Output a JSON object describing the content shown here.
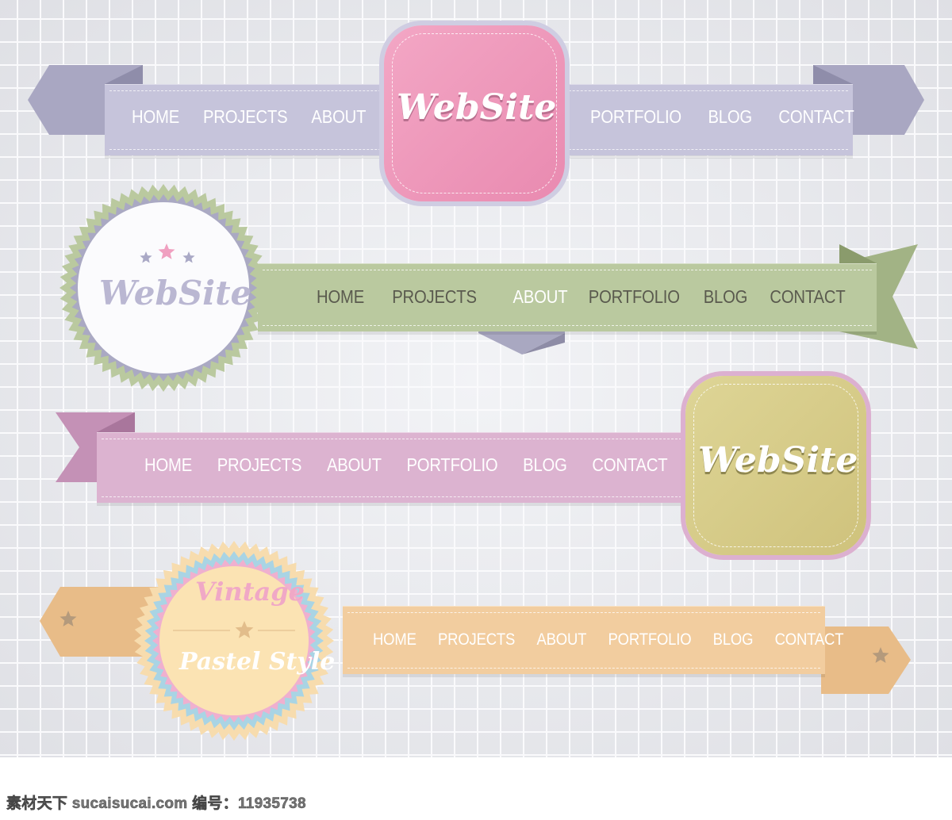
{
  "banners": [
    {
      "logo": "WebSite",
      "items_left": [
        "HOME",
        "PROJECTS",
        "ABOUT"
      ],
      "items_right": [
        "PORTFOLIO",
        "BLOG",
        "CONTACT"
      ],
      "colors": {
        "ribbon": "#c6c4db",
        "tail": "#a9a7c2",
        "badge": "#ef9cbd",
        "text": "#ffffff"
      }
    },
    {
      "logo": "WebSite",
      "items": [
        "HOME",
        "PROJECTS",
        "ABOUT",
        "PORTFOLIO",
        "BLOG",
        "CONTACT"
      ],
      "active": "ABOUT",
      "colors": {
        "ribbon": "#bac99f",
        "tail": "#a2b385",
        "active": "#a9a8c1",
        "text": "#5a5a4e",
        "logo": "#bab7d2"
      }
    },
    {
      "logo": "WebSite",
      "items": [
        "HOME",
        "PROJECTS",
        "ABOUT",
        "PORTFOLIO",
        "BLOG",
        "CONTACT"
      ],
      "colors": {
        "ribbon": "#dcb3d0",
        "tail": "#c491b6",
        "badge": "#d8cd8d",
        "text": "#ffffff"
      }
    },
    {
      "title": "Vintage",
      "subtitle": "Pastel Style",
      "items": [
        "HOME",
        "PROJECTS",
        "ABOUT",
        "PORTFOLIO",
        "BLOG",
        "CONTACT"
      ],
      "colors": {
        "ribbon": "#f2cd9f",
        "tail": "#e8bc88",
        "badge": "#fbe3b3",
        "text": "#ffffff"
      }
    }
  ],
  "watermark": "素材天下 sucaisucai.com  编号：11935738"
}
